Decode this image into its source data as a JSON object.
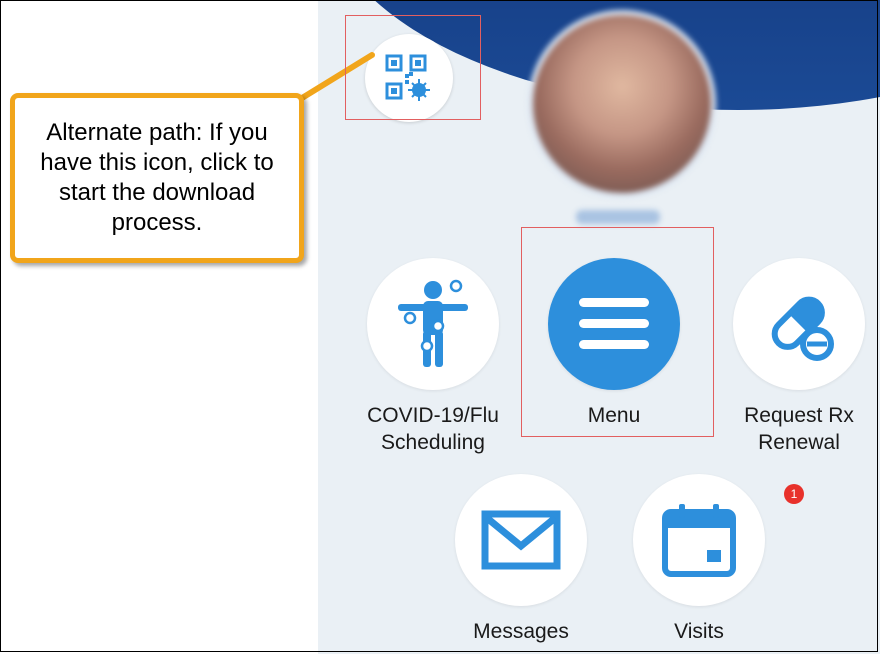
{
  "callout": {
    "text": "Alternate path: If you have this icon, click to start the download process."
  },
  "colors": {
    "header": "#0d2a6b",
    "accent": "#2d8fdc",
    "callout_border": "#f1a51b",
    "highlight": "#e25f60",
    "badge": "#e8312b",
    "background": "#eaf0f5"
  },
  "tiles": [
    {
      "label": "COVID-19/Flu\nScheduling",
      "icon": "person-vaccine-icon"
    },
    {
      "label": "Menu",
      "icon": "hamburger-menu-icon"
    },
    {
      "label": "Request Rx\nRenewal",
      "icon": "pill-capsule-icon"
    },
    {
      "label": "Messages",
      "icon": "envelope-icon"
    },
    {
      "label": "Visits",
      "icon": "calendar-icon",
      "badge": "1"
    }
  ],
  "qr": {
    "icon": "qr-code-virus-icon"
  }
}
